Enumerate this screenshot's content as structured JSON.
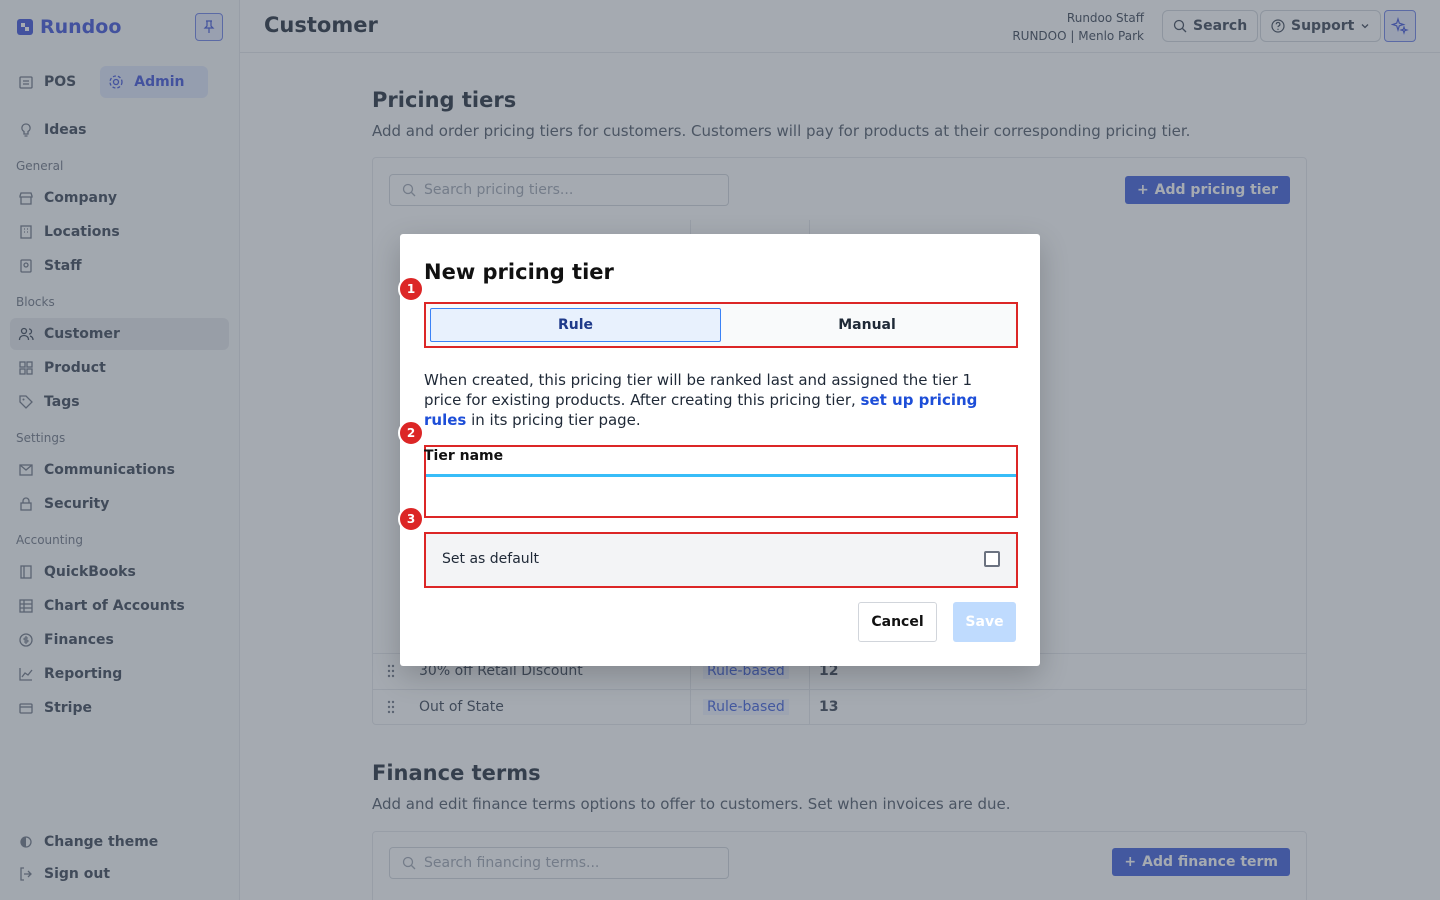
{
  "brand": {
    "name": "Rundoo"
  },
  "modes": {
    "pos": "POS",
    "admin": "Admin"
  },
  "sidebar": {
    "ideas": "Ideas",
    "sections": {
      "general": "General",
      "blocks": "Blocks",
      "settings": "Settings",
      "accounting": "Accounting"
    },
    "general": [
      "Company",
      "Locations",
      "Staff"
    ],
    "blocks": [
      "Customer",
      "Product",
      "Tags"
    ],
    "settings": [
      "Communications",
      "Security"
    ],
    "accounting": [
      "QuickBooks",
      "Chart of Accounts",
      "Finances",
      "Reporting",
      "Stripe"
    ],
    "footer": {
      "theme": "Change theme",
      "signout": "Sign out"
    }
  },
  "header": {
    "title": "Customer",
    "staff_name": "Rundoo Staff",
    "staff_location": "RUNDOO | Menlo Park",
    "search": "Search",
    "support": "Support"
  },
  "pricing": {
    "title": "Pricing tiers",
    "desc": "Add and order pricing tiers for customers. Customers will pay for products at their corresponding pricing tier.",
    "search_placeholder": "Search pricing tiers...",
    "add": "Add pricing tier",
    "rows": [
      {
        "name": "30% off Retail Discount",
        "type": "Rule-based",
        "rank": "12"
      },
      {
        "name": "Out of State",
        "type": "Rule-based",
        "rank": "13"
      }
    ]
  },
  "finance": {
    "title": "Finance terms",
    "desc": "Add and edit finance terms options to offer to customers. Set when invoices are due.",
    "search_placeholder": "Search financing terms...",
    "add": "Add finance term"
  },
  "modal": {
    "title": "New pricing tier",
    "tab_rule": "Rule",
    "tab_manual": "Manual",
    "desc_pre": "When created, this pricing tier will be ranked last and assigned the tier 1 price for existing products. After creating this pricing tier, ",
    "desc_link": "set up pricing rules",
    "desc_post": " in its pricing tier page.",
    "field_label": "Tier name",
    "field_value": "",
    "default_label": "Set as default",
    "default_checked": false,
    "cancel": "Cancel",
    "save": "Save",
    "badges": [
      "1",
      "2",
      "3"
    ]
  }
}
